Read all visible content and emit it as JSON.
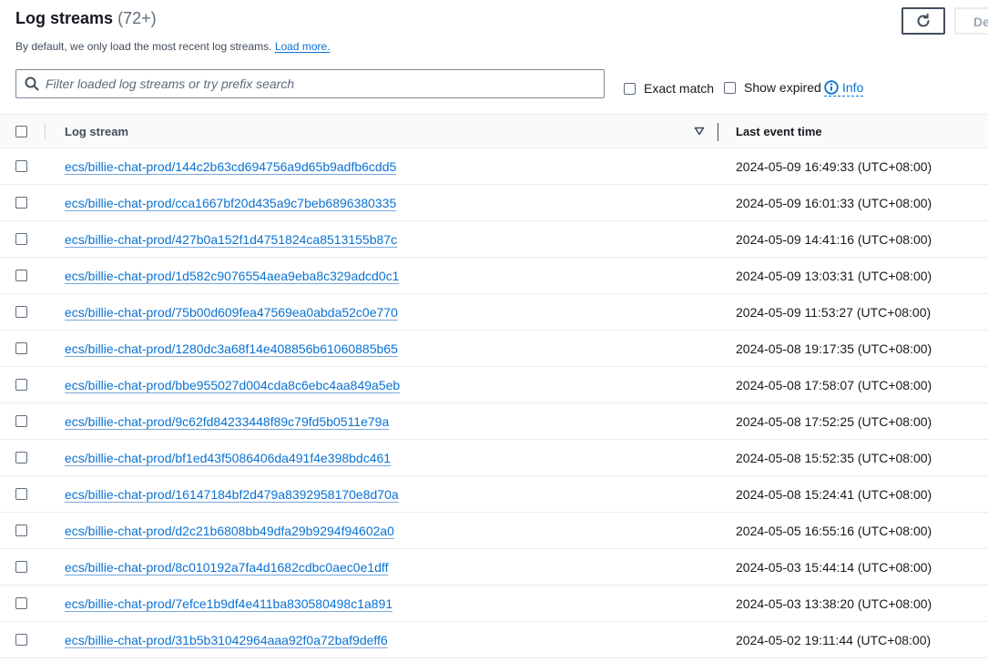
{
  "header": {
    "title": "Log streams",
    "count": "(72+)",
    "description_prefix": "By default, we only load the most recent log streams.",
    "load_more_label": "Load more.",
    "delete_label": "De"
  },
  "search": {
    "placeholder": "Filter loaded log streams or try prefix search",
    "value": ""
  },
  "options": {
    "exact_match_label": "Exact match",
    "show_expired_label": "Show expired",
    "info_label": "Info"
  },
  "table": {
    "columns": [
      "Log stream",
      "Last event time"
    ],
    "rows": [
      {
        "stream": "ecs/billie-chat-prod/144c2b63cd694756a9d65b9adfb6cdd5",
        "time": "2024-05-09 16:49:33 (UTC+08:00)"
      },
      {
        "stream": "ecs/billie-chat-prod/cca1667bf20d435a9c7beb6896380335",
        "time": "2024-05-09 16:01:33 (UTC+08:00)"
      },
      {
        "stream": "ecs/billie-chat-prod/427b0a152f1d4751824ca8513155b87c",
        "time": "2024-05-09 14:41:16 (UTC+08:00)"
      },
      {
        "stream": "ecs/billie-chat-prod/1d582c9076554aea9eba8c329adcd0c1",
        "time": "2024-05-09 13:03:31 (UTC+08:00)"
      },
      {
        "stream": "ecs/billie-chat-prod/75b00d609fea47569ea0abda52c0e770",
        "time": "2024-05-09 11:53:27 (UTC+08:00)"
      },
      {
        "stream": "ecs/billie-chat-prod/1280dc3a68f14e408856b61060885b65",
        "time": "2024-05-08 19:17:35 (UTC+08:00)"
      },
      {
        "stream": "ecs/billie-chat-prod/bbe955027d004cda8c6ebc4aa849a5eb",
        "time": "2024-05-08 17:58:07 (UTC+08:00)"
      },
      {
        "stream": "ecs/billie-chat-prod/9c62fd84233448f89c79fd5b0511e79a",
        "time": "2024-05-08 17:52:25 (UTC+08:00)"
      },
      {
        "stream": "ecs/billie-chat-prod/bf1ed43f5086406da491f4e398bdc461",
        "time": "2024-05-08 15:52:35 (UTC+08:00)"
      },
      {
        "stream": "ecs/billie-chat-prod/16147184bf2d479a8392958170e8d70a",
        "time": "2024-05-08 15:24:41 (UTC+08:00)"
      },
      {
        "stream": "ecs/billie-chat-prod/d2c21b6808bb49dfa29b9294f94602a0",
        "time": "2024-05-05 16:55:16 (UTC+08:00)"
      },
      {
        "stream": "ecs/billie-chat-prod/8c010192a7fa4d1682cdbc0aec0e1dff",
        "time": "2024-05-03 15:44:14 (UTC+08:00)"
      },
      {
        "stream": "ecs/billie-chat-prod/7efce1b9df4e411ba830580498c1a891",
        "time": "2024-05-03 13:38:20 (UTC+08:00)"
      },
      {
        "stream": "ecs/billie-chat-prod/31b5b31042964aaa92f0a72baf9deff6",
        "time": "2024-05-02 19:11:44 (UTC+08:00)"
      }
    ]
  },
  "icons": {
    "refresh": "refresh-icon",
    "search": "search-icon",
    "info": "info-icon",
    "sort": "sort-down-icon"
  },
  "colors": {
    "link": "#0972d3",
    "text": "#16191f",
    "muted": "#5f6b7a",
    "border": "#e9ebed"
  }
}
